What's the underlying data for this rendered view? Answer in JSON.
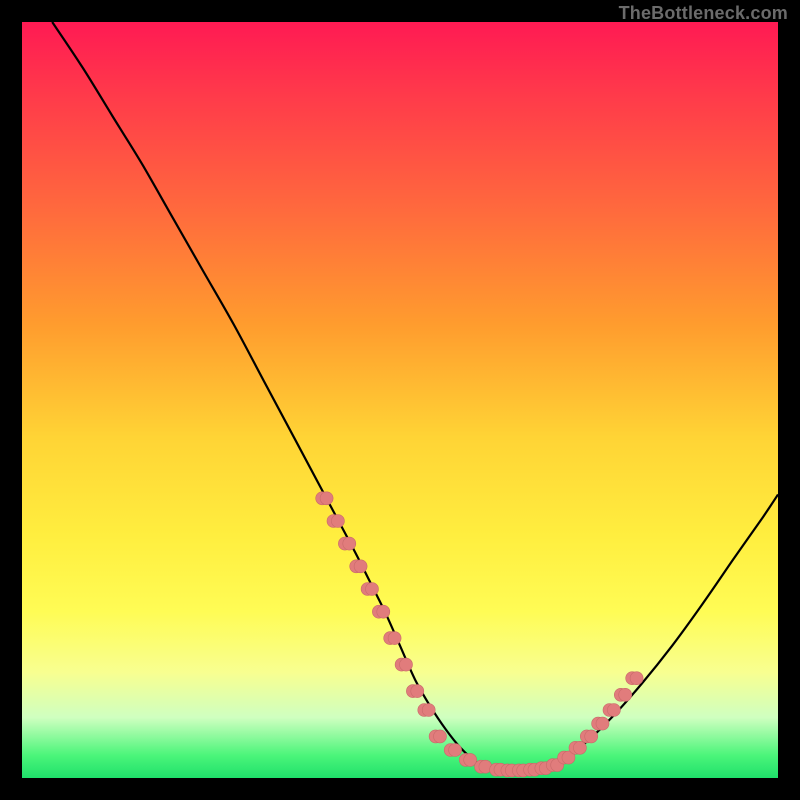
{
  "watermark": "TheBottleneck.com",
  "chart_data": {
    "type": "line",
    "title": "",
    "xlabel": "",
    "ylabel": "",
    "xlim": [
      0,
      100
    ],
    "ylim": [
      0,
      100
    ],
    "x": [
      4,
      8,
      12,
      16,
      20,
      24,
      28,
      32,
      36,
      40,
      44,
      46,
      48,
      50,
      52,
      54,
      56,
      58,
      60,
      62,
      66,
      70,
      74,
      78,
      82,
      86,
      90,
      94,
      98,
      100
    ],
    "values": [
      100,
      94,
      87.5,
      81,
      74,
      67,
      60,
      52.5,
      45,
      37.5,
      30,
      26,
      22,
      17.5,
      13,
      9.5,
      6.5,
      4,
      2.2,
      1.2,
      1,
      1.5,
      4.2,
      8,
      12.5,
      17.5,
      23,
      28.8,
      34.5,
      37.5
    ],
    "highlight_clusters": [
      {
        "side": "left",
        "x": [
          40,
          41.5,
          43,
          44.5,
          46,
          47.5,
          49,
          50.5,
          52,
          53.5
        ],
        "y": [
          37,
          34,
          31,
          28,
          25,
          22,
          18.5,
          15,
          11.5,
          9
        ]
      },
      {
        "side": "bottom",
        "x": [
          55,
          57,
          59,
          61,
          63,
          64.5,
          66,
          67.5,
          69,
          70.5
        ],
        "y": [
          5.5,
          3.7,
          2.4,
          1.5,
          1.1,
          1.0,
          1.0,
          1.1,
          1.3,
          1.7
        ]
      },
      {
        "side": "right",
        "x": [
          72,
          73.5,
          75,
          76.5,
          78,
          79.5,
          81
        ],
        "y": [
          2.7,
          4.0,
          5.5,
          7.2,
          9.0,
          11.0,
          13.2
        ]
      }
    ],
    "colors": {
      "curve": "#000000",
      "dots": "#e17c7c",
      "gradient_top": "#ff1a53",
      "gradient_mid": "#ffee3f",
      "gradient_bottom": "#1fe06b"
    }
  }
}
